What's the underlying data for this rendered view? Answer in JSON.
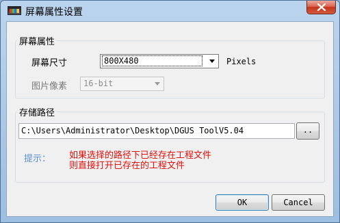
{
  "window": {
    "title": "屏幕属性设置"
  },
  "screen_group": {
    "title": "屏幕属性",
    "size_label": "屏幕尺寸",
    "size_value": "800X480",
    "size_unit": "Pixels",
    "pixel_label": "图片像素",
    "pixel_value": "16-bit"
  },
  "path_group": {
    "title": "存储路径",
    "path_value": "C:\\Users\\Administrator\\Desktop\\DGUS ToolV5.04",
    "browse_label": ".."
  },
  "hint": {
    "label": "提示：",
    "line1": "如果选择的路径下已经存在工程文件",
    "line2": "则直接打开已存在的工程文件"
  },
  "buttons": {
    "ok": "OK",
    "cancel": "Cancel"
  },
  "colors": {
    "hint_label": "#5a8fd0",
    "hint_text": "#e0100a",
    "close_button": "#c4351b"
  }
}
